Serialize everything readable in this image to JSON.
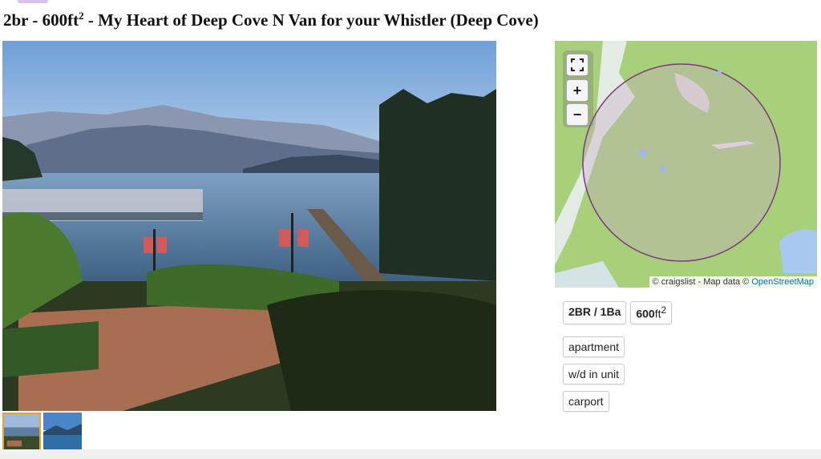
{
  "posting": {
    "title_prefix": "2br - 600ft",
    "title_sup": "2",
    "title_rest": " - My Heart of Deep Cove N Van for your Whistler",
    "title_location": " (Deep Cove)"
  },
  "gallery": {
    "thumbnail_count": 2,
    "active_index": 0
  },
  "map": {
    "attribution_prefix": "© craigslist - Map data © ",
    "attribution_link": "OpenStreetMap",
    "fullscreen_icon": "fullscreen-icon",
    "zoom_in": "+",
    "zoom_out": "−"
  },
  "attributes": {
    "bedbath": "2BR / 1Ba",
    "sqft_value": "600",
    "sqft_unit": "ft",
    "sqft_sup": "2"
  },
  "tags": [
    "apartment",
    "w/d in unit",
    "carport"
  ],
  "colors": {
    "map_land": "#a8d07a",
    "map_circle_stroke": "#7a3a7a",
    "thumb_active_border": "#f0a030",
    "link": "#0078a8"
  }
}
